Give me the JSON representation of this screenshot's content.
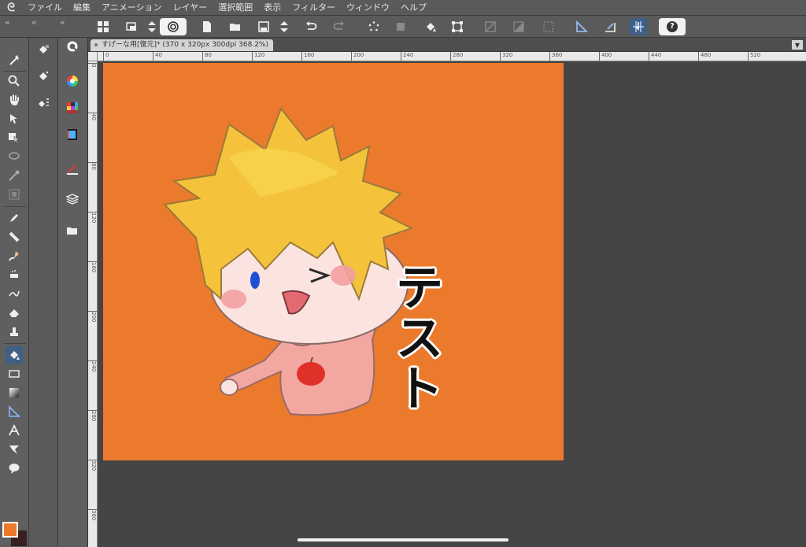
{
  "menu": {
    "logo_glyph": "ᘓ",
    "items": [
      "ファイル",
      "編集",
      "アニメーション",
      "レイヤー",
      "選択範囲",
      "表示",
      "フィルター",
      "ウィンドウ",
      "ヘルプ"
    ]
  },
  "document": {
    "tab_title": "すげーな用[復元]* (370 x 320px 300dpi 368.2%)"
  },
  "rulers": {
    "horizontal": [
      "0",
      "40",
      "80",
      "120",
      "160",
      "200",
      "240",
      "280",
      "320",
      "360",
      "400",
      "440",
      "480",
      "520"
    ],
    "vertical": [
      "0",
      "40",
      "80",
      "120",
      "160",
      "200",
      "240",
      "280",
      "320",
      "360"
    ]
  },
  "canvas": {
    "background_color": "#ec7a2c",
    "text_chars": [
      "テ",
      "ス",
      "ト"
    ]
  },
  "colors": {
    "main_color": "#ec7a2c",
    "sub_color": "#3b1f1f",
    "accent": "#3f5f86"
  },
  "toolbar": {
    "help_label": "?"
  }
}
